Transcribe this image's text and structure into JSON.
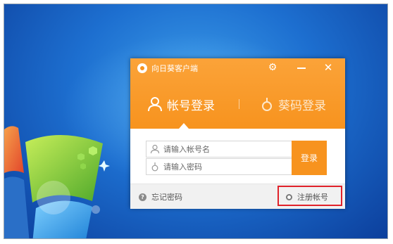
{
  "desktop": {
    "wallpaper": "windows-7-blue"
  },
  "dialog": {
    "title": "向日葵客户端",
    "icons": {
      "app": "sunflower-logo-icon",
      "settings": "gear-icon",
      "minimize": "minimize-icon",
      "close": "close-icon"
    },
    "tabs": [
      {
        "label": "帐号登录",
        "icon": "user-icon",
        "active": true
      },
      {
        "label": "葵码登录",
        "icon": "sunflower-code-icon",
        "active": false
      }
    ],
    "username_placeholder": "请输入帐号名",
    "password_placeholder": "请输入密码",
    "login_label": "登录",
    "forgot_label": "忘记密码",
    "register_label": "注册帐号",
    "accent_color": "#f7931e",
    "highlight_color": "#e0222a"
  }
}
